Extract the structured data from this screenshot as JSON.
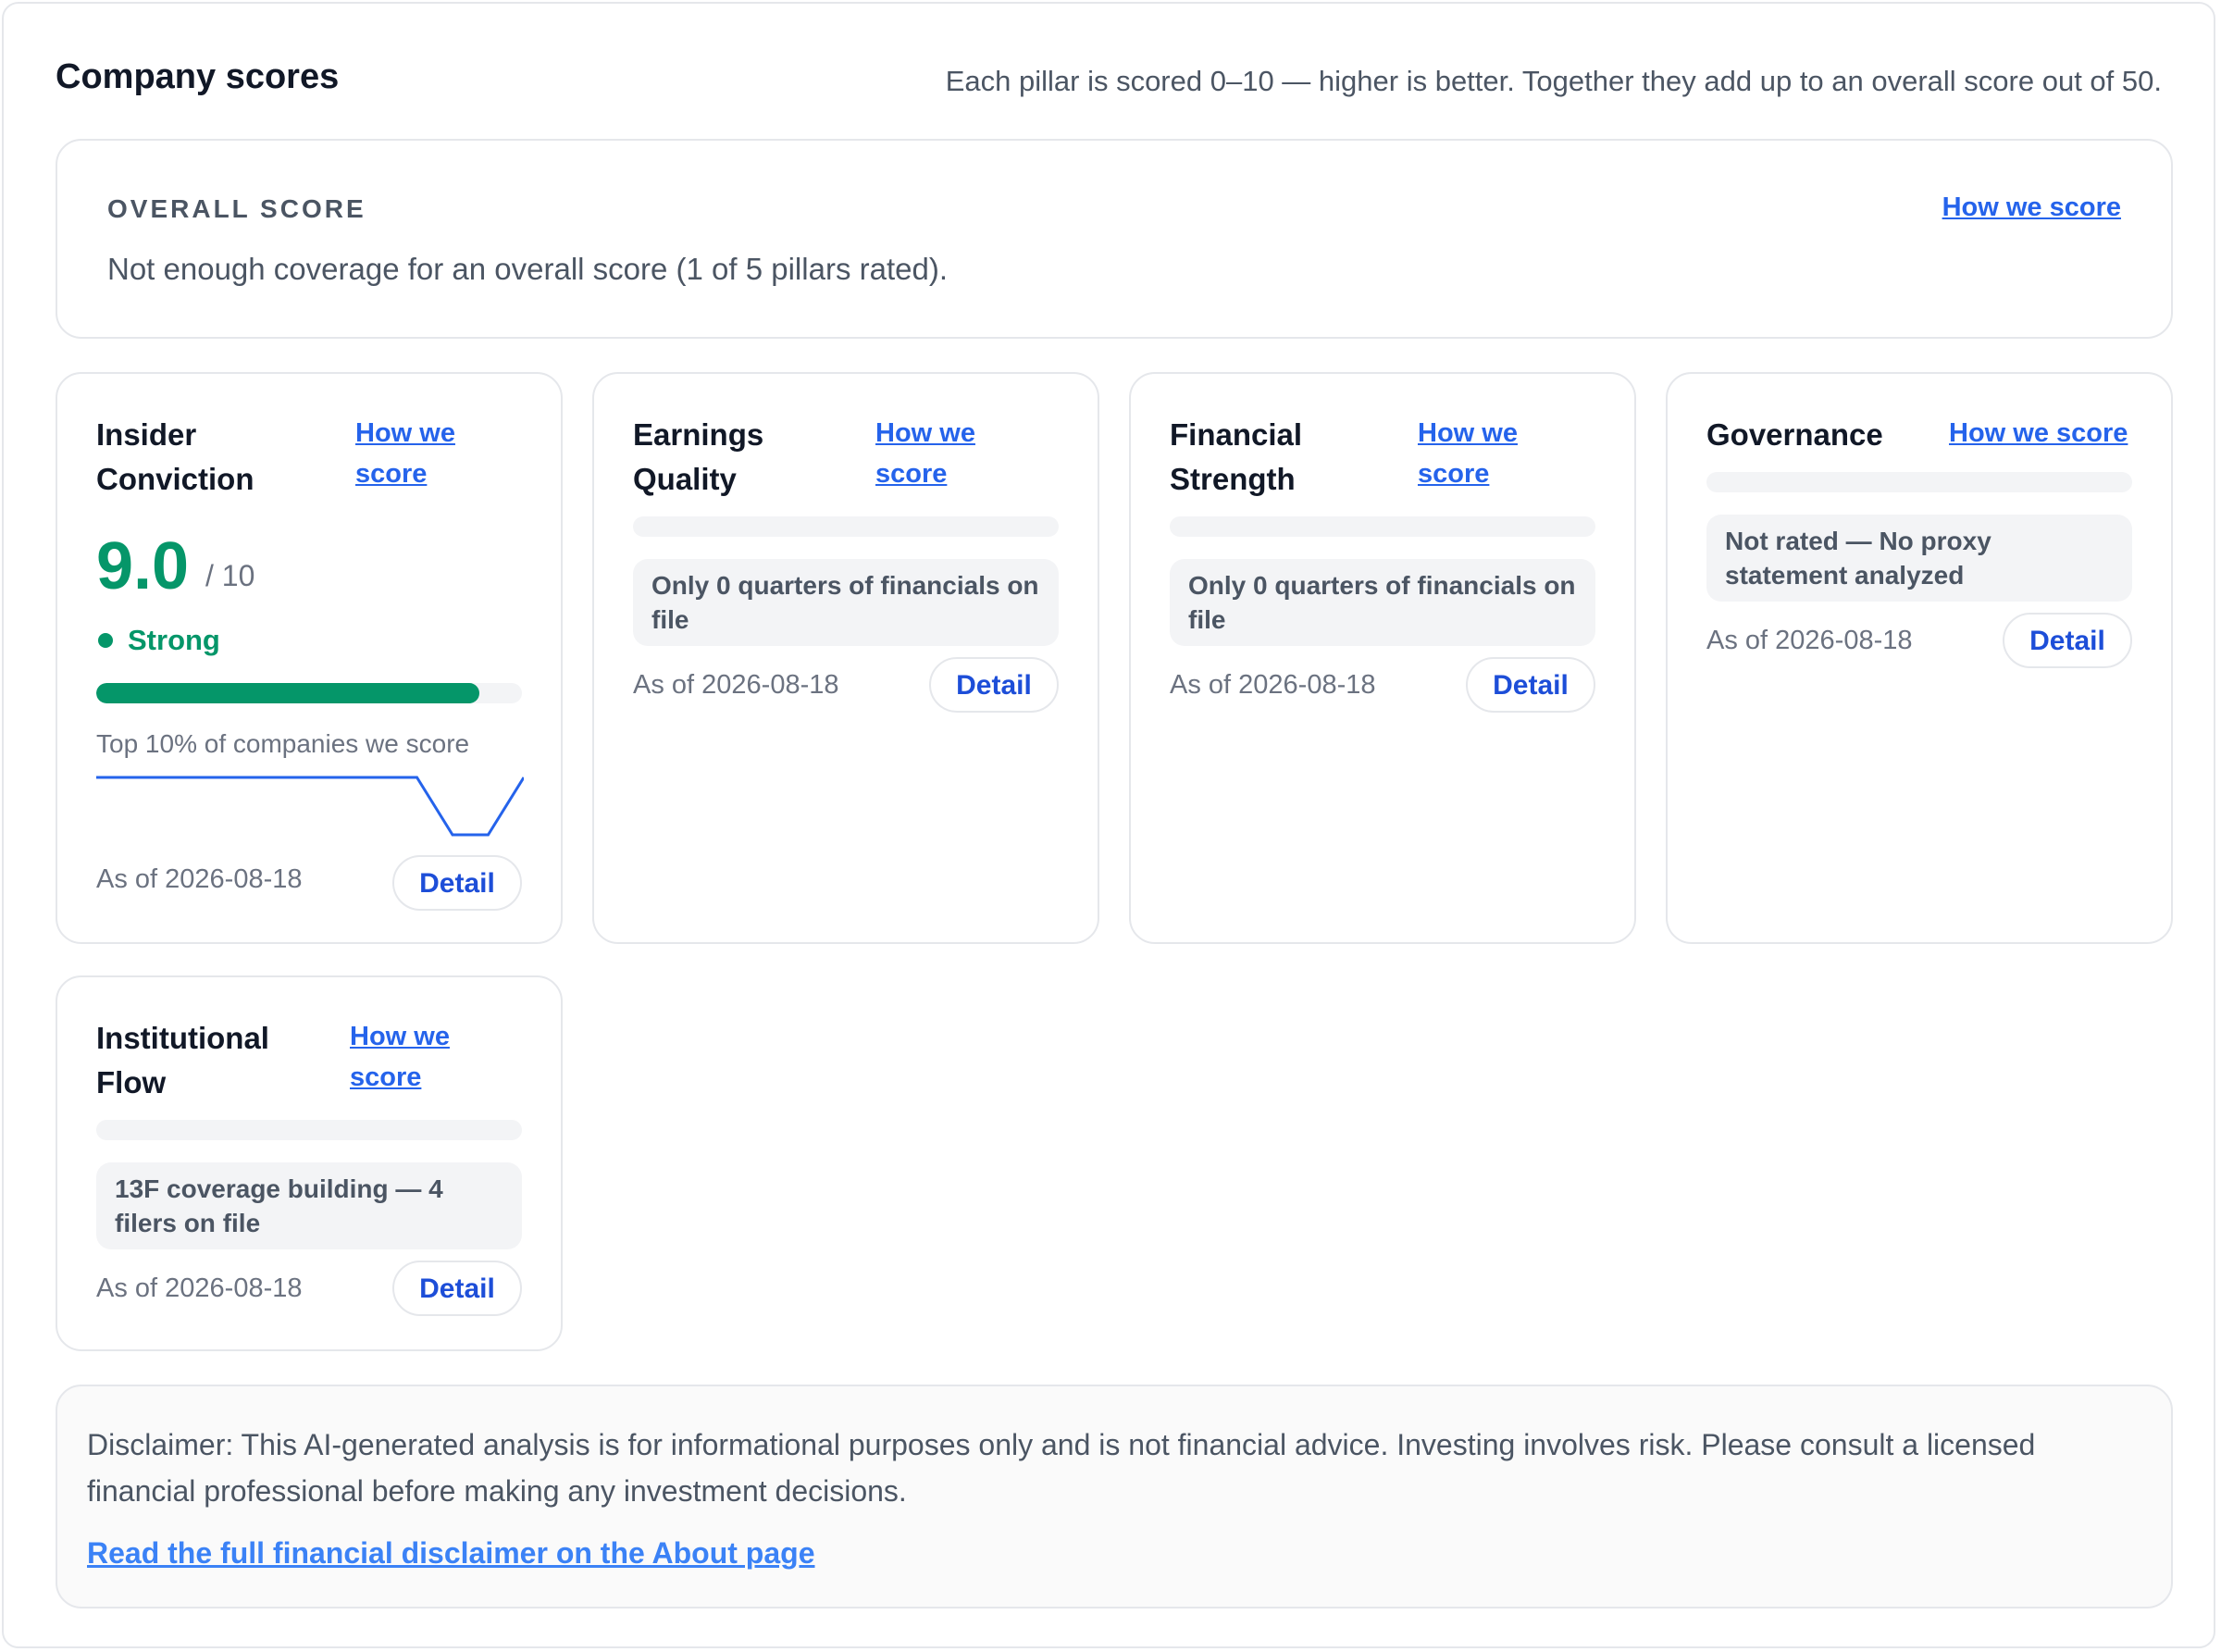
{
  "header": {
    "title": "Company scores",
    "subtitle": "Each pillar is scored 0–10 — higher is better. Together they add up to an overall score out of 50."
  },
  "overall": {
    "label": "OVERALL SCORE",
    "message": "Not enough coverage for an overall score (1 of 5 pillars rated).",
    "link": "How we score"
  },
  "pillars": [
    {
      "title": "Insider Conviction",
      "link": "How we score",
      "score": "9.0",
      "score_max": "/ 10",
      "score_fraction": 0.9,
      "status": "Strong",
      "percentile": "Top 10% of companies we score",
      "sparkline": [
        9.0,
        9.0,
        9.0,
        9.0,
        9.0,
        9.0,
        9.0,
        9.0,
        9.0,
        9.0,
        7.4,
        7.4,
        9.0
      ],
      "as_of": "As of 2026-08-18",
      "detail": "Detail"
    },
    {
      "title": "Earnings Quality",
      "link": "How we score",
      "note": "Only 0 quarters of financials on file",
      "as_of": "As of 2026-08-18",
      "detail": "Detail"
    },
    {
      "title": "Financial Strength",
      "link": "How we score",
      "note": "Only 0 quarters of financials on file",
      "as_of": "As of 2026-08-18",
      "detail": "Detail"
    },
    {
      "title": "Governance",
      "link": "How we score",
      "note": "Not rated — No proxy statement analyzed",
      "as_of": "As of 2026-08-18",
      "detail": "Detail"
    },
    {
      "title": "Institutional Flow",
      "link": "How we score",
      "note": "13F coverage building — 4 filers on file",
      "as_of": "As of 2026-08-18",
      "detail": "Detail"
    }
  ],
  "disclaimer": {
    "text": "Disclaimer: This AI-generated analysis is for informational purposes only and is not financial advice. Investing involves risk. Please consult a licensed financial professional before making any investment decisions.",
    "link": "Read the full financial disclaimer on the About page"
  },
  "colors": {
    "accent": "#2563eb",
    "strong": "#059669",
    "muted": "#6b7280",
    "border": "#e5e7eb"
  }
}
